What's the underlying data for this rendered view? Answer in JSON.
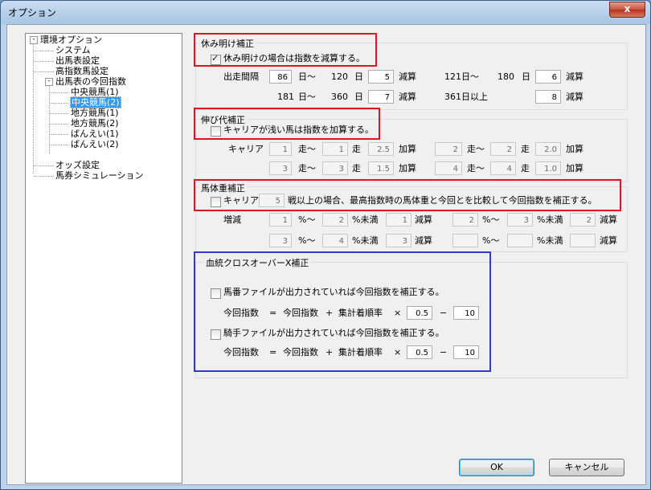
{
  "window": {
    "title": "オプション",
    "close_glyph": "x"
  },
  "tree": {
    "root": "環境オプション",
    "items": [
      "システム",
      "出馬表設定",
      "高指数馬設定",
      "出馬表の今回指数",
      "中央競馬(1)",
      "中央競馬(2)",
      "地方競馬(1)",
      "地方競馬(2)",
      "ばんえい(1)",
      "ばんえい(2)",
      "オッズ設定",
      "馬券シミュレーション"
    ],
    "expander_root": "-",
    "expander_sub": "-"
  },
  "rest": {
    "legend": "休み明け補正",
    "checkbox_label": "休み明けの場合は指数を減算する。",
    "checked": true,
    "label_interval": "出走間隔",
    "row1": {
      "from1": "86",
      "u1": "日〜",
      "to1": "120",
      "d1": "日",
      "v1": "5",
      "s1": "減算",
      "from2": "121",
      "u2": "日〜",
      "to2": "180",
      "d2": "日",
      "v2": "6",
      "s2": "減算"
    },
    "row2": {
      "from1": "181",
      "u1": "日〜",
      "to1": "360",
      "d1": "日",
      "v1": "7",
      "s1": "減算",
      "from2": "361",
      "u2": "日以上",
      "v2": "8",
      "s2": "減算"
    }
  },
  "growth": {
    "legend": "伸び代補正",
    "checkbox_label": "キャリアが浅い馬は指数を加算する。",
    "checked": false,
    "label_career": "キャリア",
    "unit_from": "走〜",
    "unit_to": "走",
    "add": "加算",
    "rows": [
      [
        {
          "a": "1",
          "b": "1",
          "c": "2.5"
        },
        {
          "a": "2",
          "b": "2",
          "c": "2.0"
        }
      ],
      [
        {
          "a": "3",
          "b": "3",
          "c": "1.5"
        },
        {
          "a": "4",
          "b": "4",
          "c": "1.0"
        }
      ]
    ]
  },
  "weight": {
    "legend": "馬体重補正",
    "checkbox_label_pre": "キャリア",
    "career_value": "5",
    "checkbox_label_post": "戦以上の場合、最高指数時の馬体重と今回とを比較して今回指数を補正する。",
    "checked": false,
    "label_change": "増減",
    "pct_from": "%〜",
    "pct_to": "%未満",
    "sub": "減算",
    "rows": [
      [
        {
          "a": "1",
          "b": "2",
          "c": "1"
        },
        {
          "a": "2",
          "b": "3",
          "c": "2"
        }
      ],
      [
        {
          "a": "3",
          "b": "4",
          "c": "3"
        },
        {
          "a": "",
          "b": "",
          "c": ""
        }
      ]
    ]
  },
  "cross": {
    "legend": "血統クロスオーバーX補正",
    "items": [
      {
        "checkbox_label": "馬番ファイルが出力されていれば今回指数を補正する。",
        "checked": false,
        "formula_a": "今回指数",
        "eq": "=",
        "formula_b": "今回指数",
        "plus": "+",
        "formula_c": "集計着順率",
        "times": "×",
        "factor": "0.5",
        "minus": "−",
        "offset": "10"
      },
      {
        "checkbox_label": "騎手ファイルが出力されていれば今回指数を補正する。",
        "checked": false,
        "formula_a": "今回指数",
        "eq": "=",
        "formula_b": "今回指数",
        "plus": "+",
        "formula_c": "集計着順率",
        "times": "×",
        "factor": "0.5",
        "minus": "−",
        "offset": "10"
      }
    ]
  },
  "buttons": {
    "ok": "OK",
    "cancel": "キャンセル"
  },
  "colors": {
    "highlight_red": "#e0141f",
    "highlight_blue": "#2d3dc8",
    "selection": "#3399ff"
  }
}
